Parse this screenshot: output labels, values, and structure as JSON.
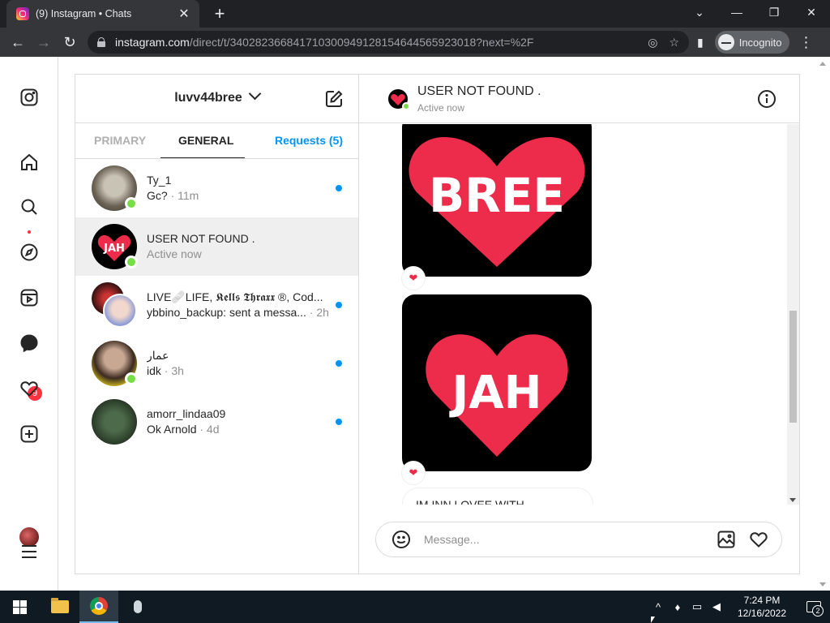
{
  "browser": {
    "tab_title": "(9) Instagram • Chats",
    "url_host": "instagram.com",
    "url_path": "/direct/t/340282366841710300949128154644565923018?next=%2F",
    "incognito_label": "Incognito"
  },
  "nav": {
    "messages_badge": "9"
  },
  "inbox": {
    "account_name": "luvv44bree",
    "tabs": {
      "primary": "PRIMARY",
      "general": "GENERAL",
      "requests": "Requests (5)"
    },
    "chats": [
      {
        "name": "Ty_1",
        "preview": "Gc?",
        "time": " · 11m",
        "unread": true,
        "online": true
      },
      {
        "name": "USER NOT FOUND .",
        "preview": "Active now",
        "time": "",
        "unread": false,
        "online": true,
        "selected": true
      },
      {
        "name": "LIVE🩹LIFE, 𝕶𝖊𝖑𝖑𝖘 𝕿𝖍𝖗𝖆𝖝𝖝 ®, Cod...",
        "preview": "ybbino_backup: sent a messa...",
        "time": " · 2h",
        "unread": true,
        "online": false
      },
      {
        "name": "عمار",
        "preview": "idk",
        "time": " · 3h",
        "unread": true,
        "online": true
      },
      {
        "name": "amorr_lindaa09",
        "preview": "Ok Arnold",
        "time": " · 4d",
        "unread": true,
        "online": false
      }
    ]
  },
  "conversation": {
    "title": "USER NOT FOUND .",
    "status": "Active now",
    "messages": [
      {
        "type": "image",
        "heart_text": "BREE",
        "reaction": "❤"
      },
      {
        "type": "image",
        "heart_text": "JAH",
        "reaction": "❤"
      },
      {
        "type": "text",
        "text": "IM INN LOVEE WITH"
      }
    ],
    "composer_placeholder": "Message...",
    "accent_color": "#ed2b4b"
  },
  "taskbar": {
    "time": "7:24 PM",
    "date": "12/16/2022",
    "notification_count": "2"
  }
}
